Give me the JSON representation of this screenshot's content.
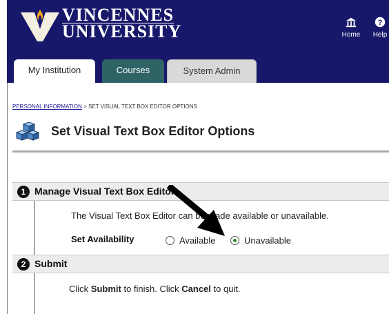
{
  "header": {
    "brand_line1": "VINCENNES",
    "brand_line2": "UNIVERSITY",
    "links": {
      "home": "Home",
      "help": "Help"
    },
    "bg_color": "#18186b"
  },
  "tabs": [
    {
      "label": "My Institution",
      "active": true
    },
    {
      "label": "Courses",
      "active": false
    },
    {
      "label": "System Admin",
      "active": false
    }
  ],
  "breadcrumb": {
    "link": "PERSONAL INFORMATION",
    "separator": " > ",
    "current": "SET VISUAL TEXT BOX EDITOR OPTIONS"
  },
  "page_title": "Set Visual Text Box Editor Options",
  "step1": {
    "number": "1",
    "title": "Manage Visual Text Box Editor",
    "description": "The Visual Text Box Editor can be made available or unavailable.",
    "availability_label": "Set Availability",
    "options": [
      {
        "label": "Available",
        "selected": false
      },
      {
        "label": "Unavailable",
        "selected": true
      }
    ]
  },
  "step2": {
    "number": "2",
    "title": "Submit",
    "text_prefix": "Click ",
    "submit_word": "Submit",
    "text_middle": " to finish. Click ",
    "cancel_word": "Cancel",
    "text_suffix": " to quit."
  },
  "icons": [
    "university-logo-icon",
    "home-icon",
    "help-icon",
    "settings-blocks-icon",
    "pointer-arrow-icon"
  ]
}
